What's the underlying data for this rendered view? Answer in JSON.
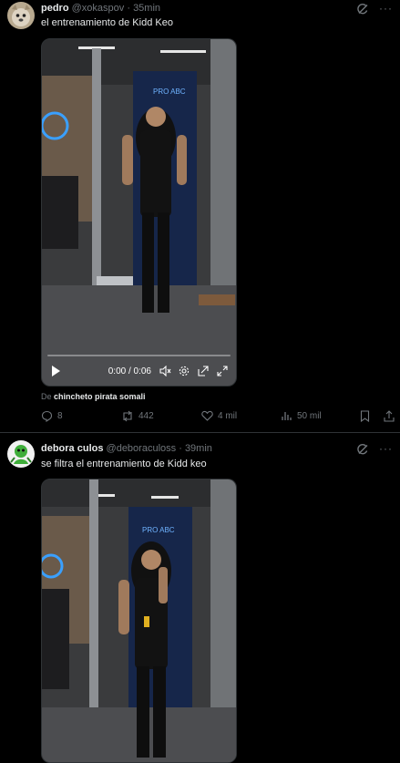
{
  "posts": [
    {
      "display_name": "pedro",
      "handle": "@xokaspov",
      "separator": "·",
      "time": "35min",
      "text": "el entrenamiento de Kidd Keo",
      "video": {
        "time_display": "0:00 / 0:06",
        "progress": 0.0,
        "gym_sign": "PRO ABC"
      },
      "attribution_prefix": "De",
      "attribution_name": "chincheto pirata somali",
      "replies": "8",
      "reposts": "442",
      "likes": "4 mil",
      "views": "50 mil"
    },
    {
      "display_name": "debora culos",
      "handle": "@deboraculoss",
      "separator": "·",
      "time": "39min",
      "text": "se filtra el entrenamiento de Kidd keo",
      "video": {
        "gym_sign": "PRO ABC"
      }
    }
  ],
  "colors": {
    "background": "#000000",
    "text": "#e7e9ea",
    "muted": "#71767b",
    "divider": "#2f3336"
  },
  "icons": [
    "grok-icon",
    "more-icon",
    "reply-icon",
    "repost-icon",
    "like-icon",
    "views-icon",
    "bookmark-icon",
    "share-icon",
    "play-icon",
    "volume-icon",
    "settings-icon",
    "pip-icon",
    "fullscreen-icon"
  ]
}
